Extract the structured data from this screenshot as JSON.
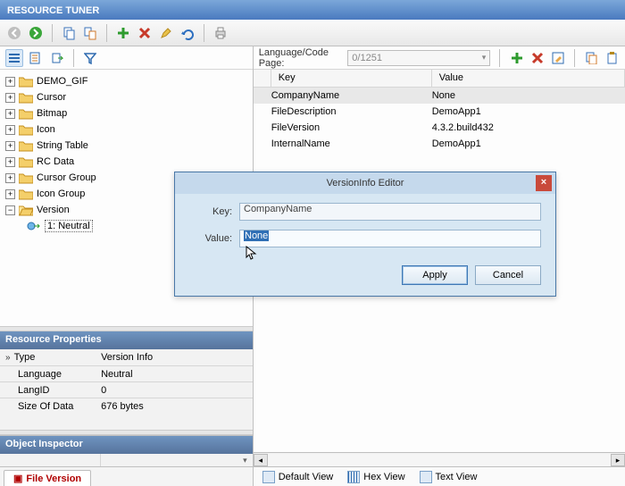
{
  "app": {
    "title": "RESOURCE TUNER"
  },
  "tree": {
    "items": [
      {
        "label": "DEMO_GIF"
      },
      {
        "label": "Cursor"
      },
      {
        "label": "Bitmap"
      },
      {
        "label": "Icon"
      },
      {
        "label": "String Table"
      },
      {
        "label": "RC Data"
      },
      {
        "label": "Cursor Group"
      },
      {
        "label": "Icon Group"
      },
      {
        "label": "Version",
        "expanded": true,
        "children": [
          {
            "label": "1: Neutral"
          }
        ]
      }
    ]
  },
  "res_props": {
    "header": "Resource Properties",
    "rows": [
      {
        "k": "Type",
        "v": "Version Info",
        "chev": true
      },
      {
        "k": "Language",
        "v": "Neutral"
      },
      {
        "k": "LangID",
        "v": "0"
      },
      {
        "k": "Size Of Data",
        "v": "676 bytes"
      }
    ]
  },
  "obj_inspector": {
    "header": "Object Inspector"
  },
  "left_tabs": {
    "active": "File Version"
  },
  "right_toolbar": {
    "lang_label": "Language/Code Page:",
    "lang_value": "0/1251"
  },
  "kv": {
    "headers": {
      "key": "Key",
      "value": "Value"
    },
    "rows": [
      {
        "key": "CompanyName",
        "value": "None",
        "sel": true
      },
      {
        "key": "FileDescription",
        "value": "DemoApp1"
      },
      {
        "key": "FileVersion",
        "value": "4.3.2.build432"
      },
      {
        "key": "InternalName",
        "value": "DemoApp1"
      }
    ]
  },
  "view_tabs": {
    "items": [
      {
        "label": "Default View"
      },
      {
        "label": "Hex View"
      },
      {
        "label": "Text View"
      }
    ]
  },
  "dialog": {
    "title": "VersionInfo Editor",
    "key_label": "Key:",
    "value_label": "Value:",
    "key": "CompanyName",
    "value": "None",
    "apply": "Apply",
    "cancel": "Cancel"
  }
}
